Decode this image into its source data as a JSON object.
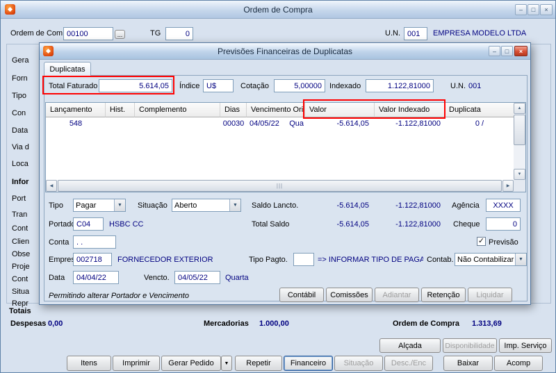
{
  "glyphs": {
    "minimize": "–",
    "maximize": "□",
    "close": "×",
    "dropdown": "▼",
    "check": "✓",
    "arrow_up": "▲",
    "arrow_down": "▼",
    "arrow_left": "◀",
    "arrow_right": "▶",
    "grip": "|||",
    "ellipsis": "..."
  },
  "colors": {
    "highlight_red": "#FF0000",
    "value_navy": "#000080"
  },
  "main_window": {
    "title": "Ordem de Compra",
    "header": {
      "order_label": "Ordem de Compra",
      "order_value": "00100",
      "tg_label": "TG",
      "tg_value": "0",
      "un_label": "U.N.",
      "un_value": "001",
      "company_name": "EMPRESA MODELO LTDA"
    },
    "left_panel": {
      "items": [
        "Gera",
        "Forn",
        "Tipo",
        "Con",
        "Data",
        "Via d",
        "Loca",
        "Infor",
        "Port",
        "Tran",
        "Cont",
        "Clien",
        "Obse",
        "Proje",
        "Cont",
        "Situa",
        "Repr"
      ]
    },
    "totals": {
      "section_title": "Totais",
      "despesas_label": "Despesas",
      "despesas_value": "0,00",
      "mercadorias_label": "Mercadorias",
      "mercadorias_value": "1.000,00",
      "ordem_label": "Ordem de Compra",
      "ordem_value": "1.313,69"
    },
    "action_buttons_right": [
      {
        "label": "Alçada",
        "disabled": false
      },
      {
        "label": "Disponibilidade",
        "disabled": true
      },
      {
        "label": "Imp. Serviço",
        "disabled": false
      }
    ],
    "bottom_buttons": [
      {
        "label": "Itens",
        "disabled": false
      },
      {
        "label": "Imprimir",
        "disabled": false
      },
      {
        "label": "Gerar Pedido",
        "disabled": false
      },
      {
        "label": "Repetir",
        "disabled": false
      },
      {
        "label": "Financeiro",
        "disabled": false,
        "focused": true
      },
      {
        "label": "Situação",
        "disabled": true
      },
      {
        "label": "Desc./Enc",
        "disabled": true
      },
      {
        "label": "Baixar",
        "disabled": false
      },
      {
        "label": "Acomp",
        "disabled": false
      }
    ]
  },
  "dialog": {
    "title": "Previsões Financeiras de Duplicatas",
    "tab_label": "Duplicatas",
    "summary": {
      "total_faturado_label": "Total Faturado",
      "total_faturado_value": "5.614,05",
      "indice_label": "Índice",
      "indice_value": "U$",
      "cotacao_label": "Cotação",
      "cotacao_value": "5,00000",
      "indexado_label": "Indexado",
      "indexado_value": "1.122,81000",
      "un_label": "U.N.",
      "un_value": "001"
    },
    "grid": {
      "columns": [
        "Lançamento",
        "Hist.",
        "Complemento",
        "Dias",
        "Vencimento Orig.",
        "Valor",
        "Valor Indexado",
        "Duplicata"
      ],
      "rows": [
        {
          "lancamento": "548",
          "hist": "",
          "complemento": "",
          "dias": "00030",
          "vencimento": "04/05/22",
          "dia_semana": "Qua",
          "valor": "-5.614,05",
          "valor_indexado": "-1.122,81000",
          "duplicata": "0 /"
        }
      ]
    },
    "form": {
      "tipo_label": "Tipo",
      "tipo_value": "Pagar",
      "situacao_label": "Situação",
      "situacao_value": "Aberto",
      "saldo_lancto_label": "Saldo Lancto.",
      "saldo_lancto_v1": "-5.614,05",
      "saldo_lancto_v2": "-1.122,81000",
      "agencia_label": "Agência",
      "agencia_value": "XXXX",
      "portador_label": "Portador",
      "portador_value": "C04",
      "portador_desc": "HSBC CC",
      "total_saldo_label": "Total Saldo",
      "total_saldo_v1": "-5.614,05",
      "total_saldo_v2": "-1.122,81000",
      "cheque_label": "Cheque",
      "cheque_value": "0",
      "conta_label": "Conta",
      "conta_value": ". .",
      "previsao_label": "Previsão",
      "previsao_checked": true,
      "empresa_label": "Empresa",
      "empresa_value": "002718",
      "empresa_desc": "FORNECEDOR EXTERIOR",
      "tipo_pagto_label": "Tipo Pagto.",
      "tipo_pagto_value": "",
      "tipo_pagto_hint": "=> INFORMAR TIPO DE PAGAM",
      "contab_label": "Contab.",
      "contab_value": "Não Contabilizar",
      "data_label": "Data",
      "data_value": "04/04/22",
      "vencto_label": "Vencto.",
      "vencto_value": "04/05/22",
      "vencto_dia": "Quarta",
      "note": "Permitindo alterar Portador e Vencimento"
    },
    "footer_buttons": [
      {
        "label": "Contábil",
        "disabled": false
      },
      {
        "label": "Comissões",
        "disabled": false
      },
      {
        "label": "Adiantar",
        "disabled": true
      },
      {
        "label": "Retenção",
        "disabled": false
      },
      {
        "label": "Liquidar",
        "disabled": true
      }
    ]
  }
}
